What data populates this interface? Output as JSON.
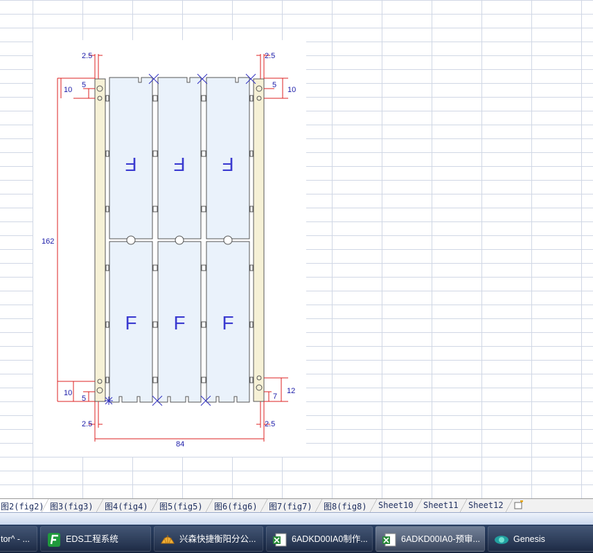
{
  "drawing": {
    "dimensions": {
      "left_top_offset": "2.5",
      "right_top_offset": "2.5",
      "left_top_outer": "10",
      "left_top_inner": "5",
      "right_top_inner": "5",
      "right_top_outer": "10",
      "overall_height": "162",
      "left_bottom_outer": "10",
      "left_bottom_inner": "5",
      "right_bottom_outer": "12",
      "right_bottom_inner": "7",
      "left_bottom_offset": "2.5",
      "right_bottom_offset": "2.5",
      "overall_width": "84"
    },
    "panel_marks": {
      "top_row": "F",
      "bottom_row": "F"
    },
    "colors": {
      "board_fill": "#eaf2fb",
      "rail_fill": "#f6f1d6",
      "outline": "#555555",
      "dimension_line": "#dd2020",
      "dimension_text": "#1a1aa8"
    }
  },
  "sheet_tabs": [
    {
      "label": "图2(fig2)",
      "active": true
    },
    {
      "label": "图3(fig3)",
      "active": false
    },
    {
      "label": "图4(fig4)",
      "active": false
    },
    {
      "label": "图5(fig5)",
      "active": false
    },
    {
      "label": "图6(fig6)",
      "active": false
    },
    {
      "label": "图7(fig7)",
      "active": false
    },
    {
      "label": "图8(fig8)",
      "active": false
    },
    {
      "label": "Sheet10",
      "active": false
    },
    {
      "label": "Sheet11",
      "active": false
    },
    {
      "label": "Sheet12",
      "active": false
    }
  ],
  "taskbar": {
    "items": [
      {
        "label": "tor^ - ...",
        "icon": "app-icon"
      },
      {
        "label": "EDS工程系统",
        "icon": "eds-logo-icon"
      },
      {
        "label": "兴森快捷衡阳分公...",
        "icon": "shell-icon"
      },
      {
        "label": "6ADKD00IA0制作...",
        "icon": "excel-icon"
      },
      {
        "label": "6ADKD00IA0-预审...",
        "icon": "excel-icon",
        "active": true
      },
      {
        "label": "Genesis",
        "icon": "genesis-icon"
      }
    ]
  }
}
